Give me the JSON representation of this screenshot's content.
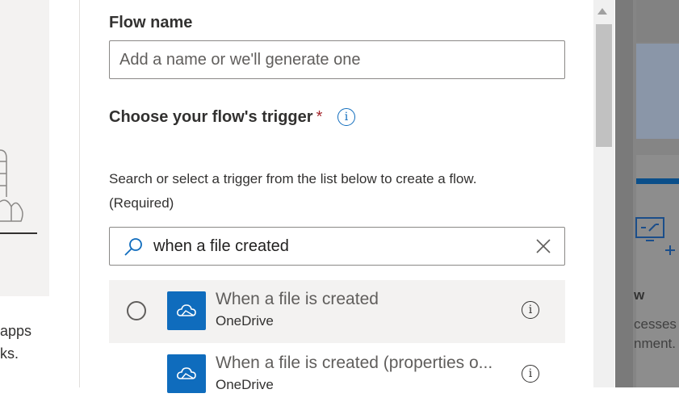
{
  "background_left": {
    "text_line1": "apps",
    "text_line2": "ks."
  },
  "dialog": {
    "flow_name_label": "Flow name",
    "flow_name_placeholder": "Add a name or we'll generate one",
    "flow_name_value": "",
    "trigger_label": "Choose your flow's trigger",
    "required_marker": "*",
    "helper_text": "Search or select a trigger from the list below to create a flow.",
    "helper_required": "(Required)",
    "search_value": "when a file created",
    "triggers": [
      {
        "title": "When a file is created",
        "connector": "OneDrive",
        "icon": "onedrive-icon",
        "selected": false,
        "highlighted": true
      },
      {
        "title": "When a file is created (properties o...",
        "connector": "OneDrive",
        "icon": "onedrive-icon",
        "selected": false,
        "highlighted": false
      }
    ]
  },
  "background_right": {
    "text_1": "w",
    "text_2": "cesses\nnment."
  },
  "colors": {
    "accent": "#0f6cbd",
    "required": "#a4262c",
    "row_highlight": "#f3f2f1"
  }
}
